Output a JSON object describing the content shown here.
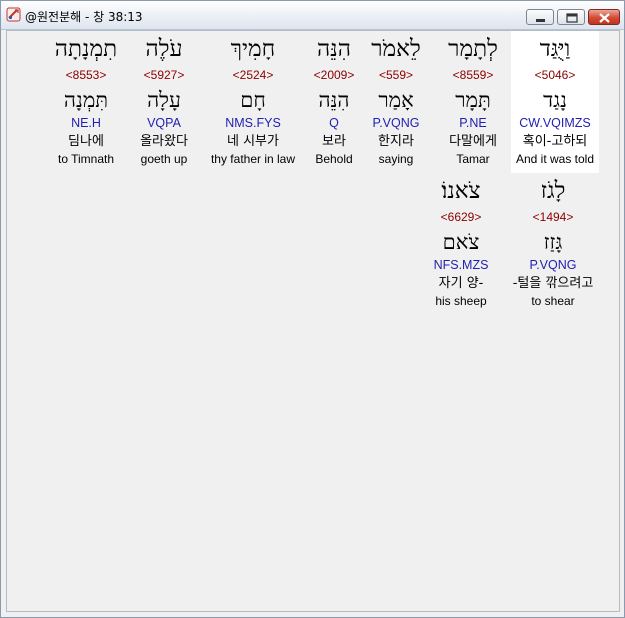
{
  "window": {
    "title": "@원전분해 - 창 38:13"
  },
  "rows": [
    {
      "words": [
        {
          "hebrew": "וַיֻּגַּד",
          "strong": "<5046>",
          "lemma": "נָגַד",
          "morph": "CW.VQIMZS",
          "korean": "혹이-고하되",
          "english": "And it was told",
          "highlight": true
        },
        {
          "hebrew": "לְתָמָר",
          "strong": "<8559>",
          "lemma": "תָּמָר",
          "morph": "P.NE",
          "korean": "다말에게",
          "english": "Tamar",
          "highlight": false
        },
        {
          "hebrew": "לֵאמֹר",
          "strong": "<559>",
          "lemma": "אָמַר",
          "morph": "P.VQNG",
          "korean": "한지라",
          "english": "saying",
          "highlight": false
        },
        {
          "hebrew": "הִנֵּה",
          "strong": "<2009>",
          "lemma": "הִנֵּה",
          "morph": "Q",
          "korean": "보라",
          "english": "Behold",
          "highlight": false
        },
        {
          "hebrew": "חָמִיךְ",
          "strong": "<2524>",
          "lemma": "חָם",
          "morph": "NMS.FYS",
          "korean": "네 시부가",
          "english": "thy father in law",
          "highlight": false
        },
        {
          "hebrew": "עֹלֶה",
          "strong": "<5927>",
          "lemma": "עָלָה",
          "morph": "VQPA",
          "korean": "올라왔다",
          "english": "goeth up",
          "highlight": false
        },
        {
          "hebrew": "תִמְנָתָה",
          "strong": "<8553>",
          "lemma": "תִּמְנָה",
          "morph": "NE.H",
          "korean": "딤나에",
          "english": "to Timnath",
          "highlight": false
        }
      ]
    },
    {
      "words": [
        {
          "hebrew": "לָגֹז",
          "strong": "<1494>",
          "lemma": "גָּזַז",
          "morph": "P.VQNG",
          "korean": "-털을 깎으려고",
          "english": "to shear",
          "highlight": false
        },
        {
          "hebrew": "צֹאנוֹ׃",
          "strong": "<6629>",
          "lemma": "צֹאם",
          "morph": "NFS.MZS",
          "korean": "자기 양-",
          "english": "his sheep",
          "highlight": false
        }
      ]
    }
  ]
}
